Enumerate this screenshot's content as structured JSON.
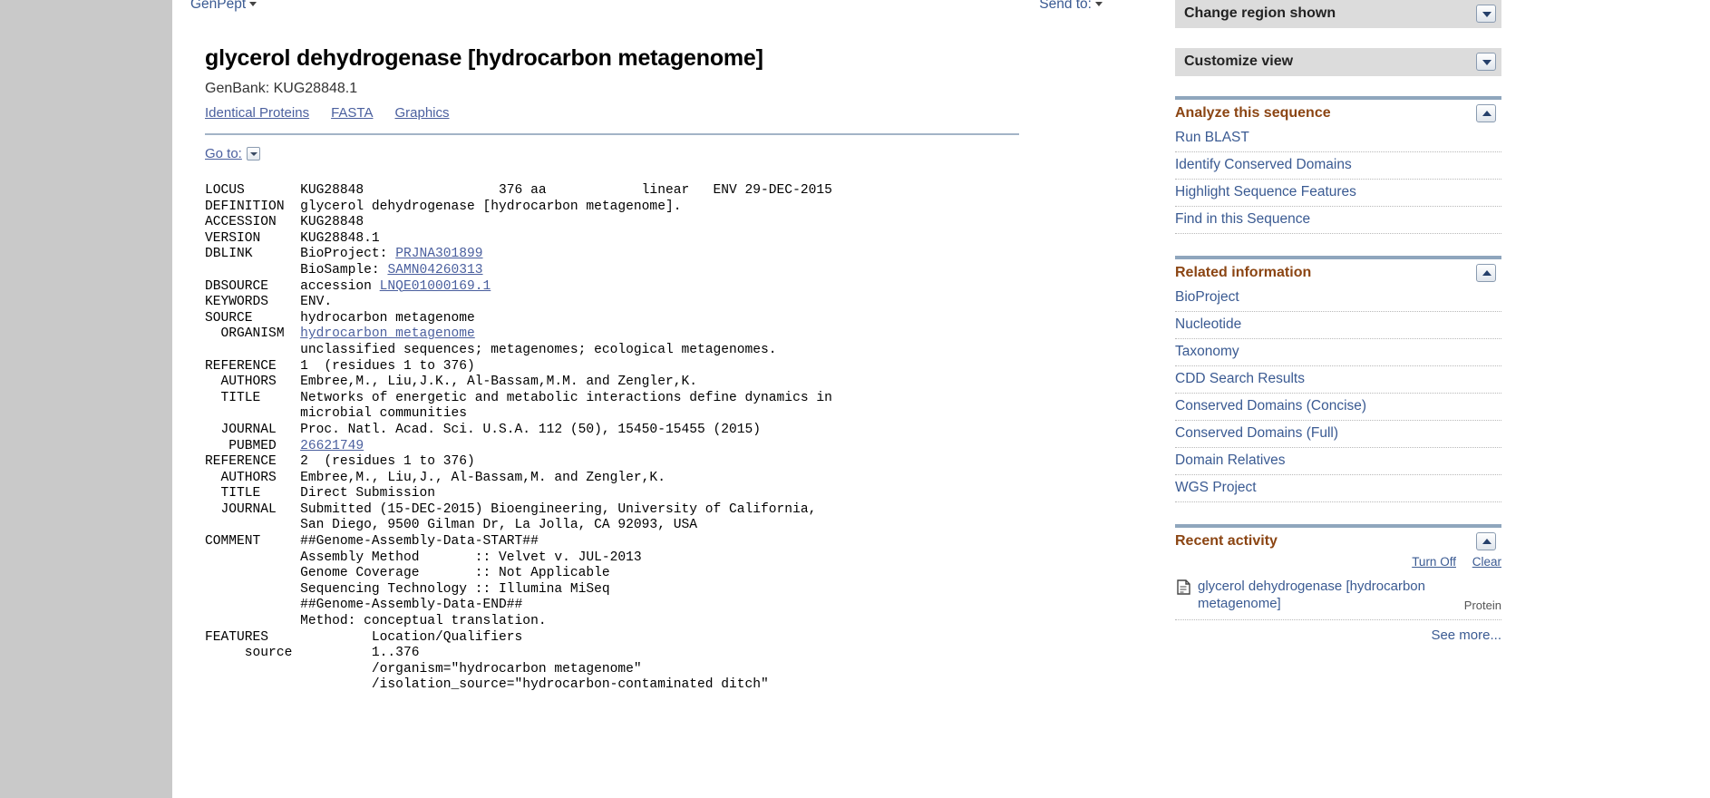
{
  "topbar": {
    "format_label": "GenPept",
    "send_to_label": "Send to:"
  },
  "record": {
    "title": "glycerol dehydrogenase [hydrocarbon metagenome]",
    "accession_line": "GenBank: KUG28848.1",
    "links": [
      "Identical Proteins",
      "FASTA",
      "Graphics"
    ],
    "goto_label": "Go to:"
  },
  "flatfile": {
    "lines": [
      {
        "text": "LOCUS       KUG28848                 376 aa            linear   ENV 29-DEC-2015"
      },
      {
        "text": "DEFINITION  glycerol dehydrogenase [hydrocarbon metagenome]."
      },
      {
        "text": "ACCESSION   KUG28848"
      },
      {
        "text": "VERSION     KUG28848.1"
      },
      {
        "text": "DBLINK      BioProject: ",
        "link": "PRJNA301899",
        "after": ""
      },
      {
        "text": "            BioSample: ",
        "link": "SAMN04260313",
        "after": ""
      },
      {
        "text": "DBSOURCE    accession ",
        "link": "LNQE01000169.1",
        "after": ""
      },
      {
        "text": "KEYWORDS    ENV."
      },
      {
        "text": "SOURCE      hydrocarbon metagenome"
      },
      {
        "text": "  ORGANISM  ",
        "link": "hydrocarbon metagenome",
        "after": ""
      },
      {
        "text": "            unclassified sequences; metagenomes; ecological metagenomes."
      },
      {
        "text": "REFERENCE   1  (residues 1 to 376)"
      },
      {
        "text": "  AUTHORS   Embree,M., Liu,J.K., Al-Bassam,M.M. and Zengler,K."
      },
      {
        "text": "  TITLE     Networks of energetic and metabolic interactions define dynamics in"
      },
      {
        "text": "            microbial communities"
      },
      {
        "text": "  JOURNAL   Proc. Natl. Acad. Sci. U.S.A. 112 (50), 15450-15455 (2015)"
      },
      {
        "text": "   PUBMED   ",
        "link": "26621749",
        "after": ""
      },
      {
        "text": "REFERENCE   2  (residues 1 to 376)"
      },
      {
        "text": "  AUTHORS   Embree,M., Liu,J., Al-Bassam,M. and Zengler,K."
      },
      {
        "text": "  TITLE     Direct Submission"
      },
      {
        "text": "  JOURNAL   Submitted (15-DEC-2015) Bioengineering, University of California,"
      },
      {
        "text": "            San Diego, 9500 Gilman Dr, La Jolla, CA 92093, USA"
      },
      {
        "text": "COMMENT     ##Genome-Assembly-Data-START##"
      },
      {
        "text": "            Assembly Method       :: Velvet v. JUL-2013"
      },
      {
        "text": "            Genome Coverage       :: Not Applicable"
      },
      {
        "text": "            Sequencing Technology :: Illumina MiSeq"
      },
      {
        "text": "            ##Genome-Assembly-Data-END##"
      },
      {
        "text": "            Method: conceptual translation."
      },
      {
        "text": "FEATURES             Location/Qualifiers"
      },
      {
        "text": "     source          1..376"
      },
      {
        "text": "                     /organism=\"hydrocarbon metagenome\""
      },
      {
        "text": "                     /isolation_source=\"hydrocarbon-contaminated ditch\""
      }
    ]
  },
  "sidebar": {
    "change_region": {
      "title": "Change region shown"
    },
    "customize_view": {
      "title": "Customize view"
    },
    "analyze": {
      "title": "Analyze this sequence",
      "items": [
        "Run BLAST",
        "Identify Conserved Domains",
        "Highlight Sequence Features",
        "Find in this Sequence"
      ]
    },
    "related": {
      "title": "Related information",
      "items": [
        "BioProject",
        "Nucleotide",
        "Taxonomy",
        "CDD Search Results",
        "Conserved Domains (Concise)",
        "Conserved Domains (Full)",
        "Domain Relatives",
        "WGS Project"
      ]
    },
    "recent": {
      "title": "Recent activity",
      "turn_off": "Turn Off",
      "clear": "Clear",
      "items": [
        {
          "title": "glycerol dehydrogenase [hydrocarbon metagenome]",
          "type": "Protein"
        }
      ],
      "see_more": "See more..."
    }
  },
  "colors": {
    "link_blue": "#3a5a92",
    "heading_brown": "#8b4513",
    "rule_blue": "#8fa6bd",
    "panel_gray": "#dcdcdc",
    "page_gray": "#c9c9c9"
  }
}
